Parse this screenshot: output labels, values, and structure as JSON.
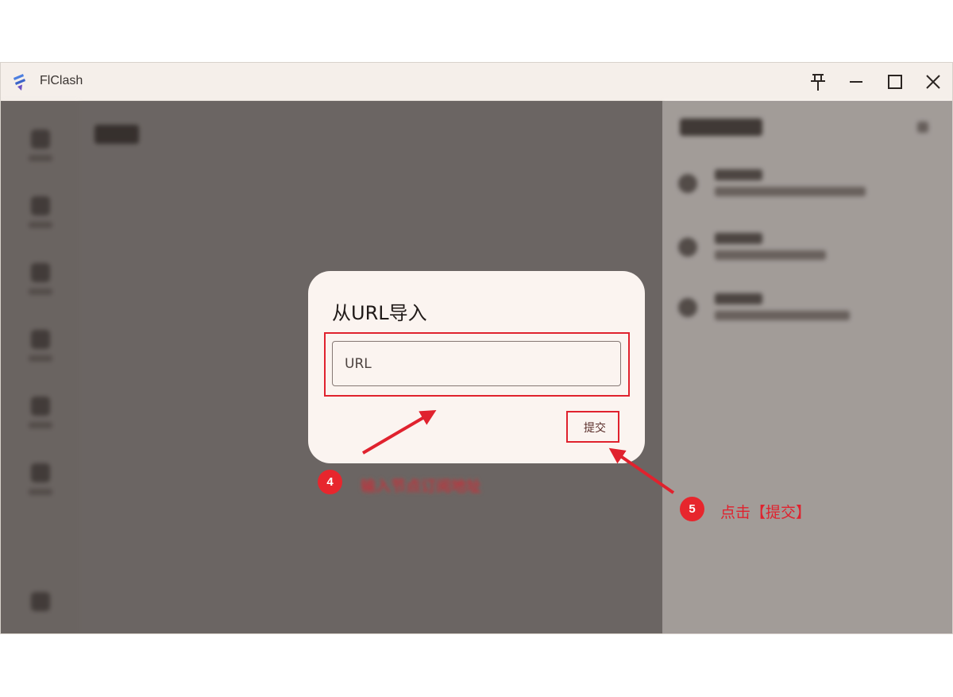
{
  "window": {
    "title": "FlClash",
    "controls": {
      "pin": "pin-icon",
      "minimize": "minimize-icon",
      "maximize": "maximize-icon",
      "close": "close-icon"
    }
  },
  "dialog": {
    "title": "从URL导入",
    "url_placeholder": "URL",
    "url_value": "",
    "submit_label": "提交"
  },
  "annotations": {
    "step4": {
      "number": "4",
      "text": "输入节点订阅地址"
    },
    "step5": {
      "number": "5",
      "text": "点击【提交】"
    },
    "color": "#e0222e"
  }
}
